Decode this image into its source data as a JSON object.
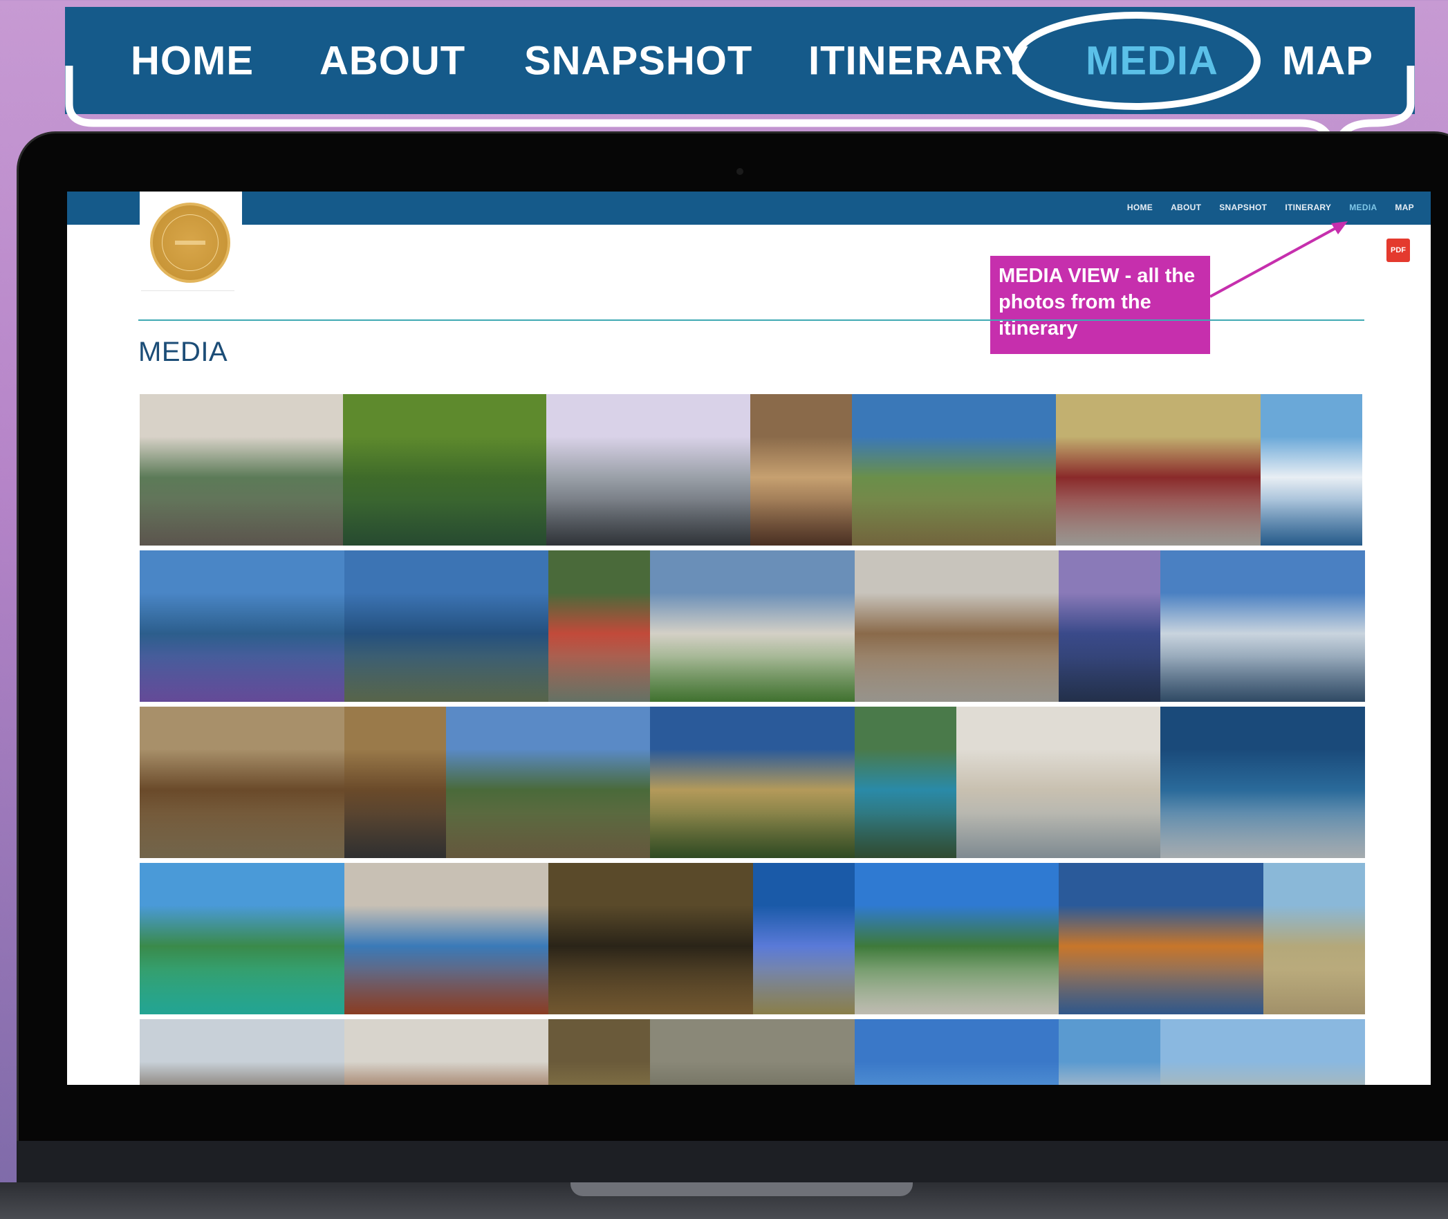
{
  "big_nav": {
    "items": [
      {
        "label": "HOME",
        "active": false
      },
      {
        "label": "ABOUT",
        "active": false
      },
      {
        "label": "SNAPSHOT",
        "active": false
      },
      {
        "label": "ITINERARY",
        "active": false
      },
      {
        "label": "MEDIA",
        "active": true
      },
      {
        "label": "MAP",
        "active": false
      }
    ],
    "active_color": "#5bc0e8"
  },
  "site": {
    "mini_nav": [
      "HOME",
      "ABOUT",
      "SNAPSHOT",
      "ITINERARY",
      "MEDIA",
      "MAP"
    ],
    "active_item": "MEDIA",
    "page_title": "MEDIA",
    "pdf_label": "PDF",
    "annotation": "MEDIA VIEW - all the photos from the itinerary",
    "brand_color": "#155a8a",
    "annotation_color": "#c62fad"
  },
  "gallery": {
    "rows": [
      [
        "tram-street",
        "green-forest-pond",
        "modern-hotel-building",
        "hotel-lobby-chandelier",
        "coastal-hills-lookout",
        "red-tram-avenue",
        "snowy-volcano-sea"
      ],
      [
        "lupin-lake-valley",
        "mountain-lake-town",
        "jet-boat-ride",
        "hotel-exterior-garden",
        "hotel-reception-interior",
        "harbour-dusk",
        "sydney-harbour-bridge"
      ],
      [
        "sandstone-building",
        "arched-facade",
        "blue-mountains-valley",
        "hikers-lookout",
        "harbour-trees-deck",
        "beach-walkers",
        "marina-aerial"
      ],
      [
        "tropical-island-lagoon",
        "resort-pool",
        "historic-interior",
        "great-barrier-reef",
        "white-beach-forest",
        "city-skyline-river",
        "boardwalk-beach"
      ],
      [
        "tower-building",
        "hotel-dining-room",
        "rock-caves",
        "limestone-cliff",
        "ocean-horizon",
        "city-towers",
        "riverside-skyline"
      ]
    ]
  }
}
